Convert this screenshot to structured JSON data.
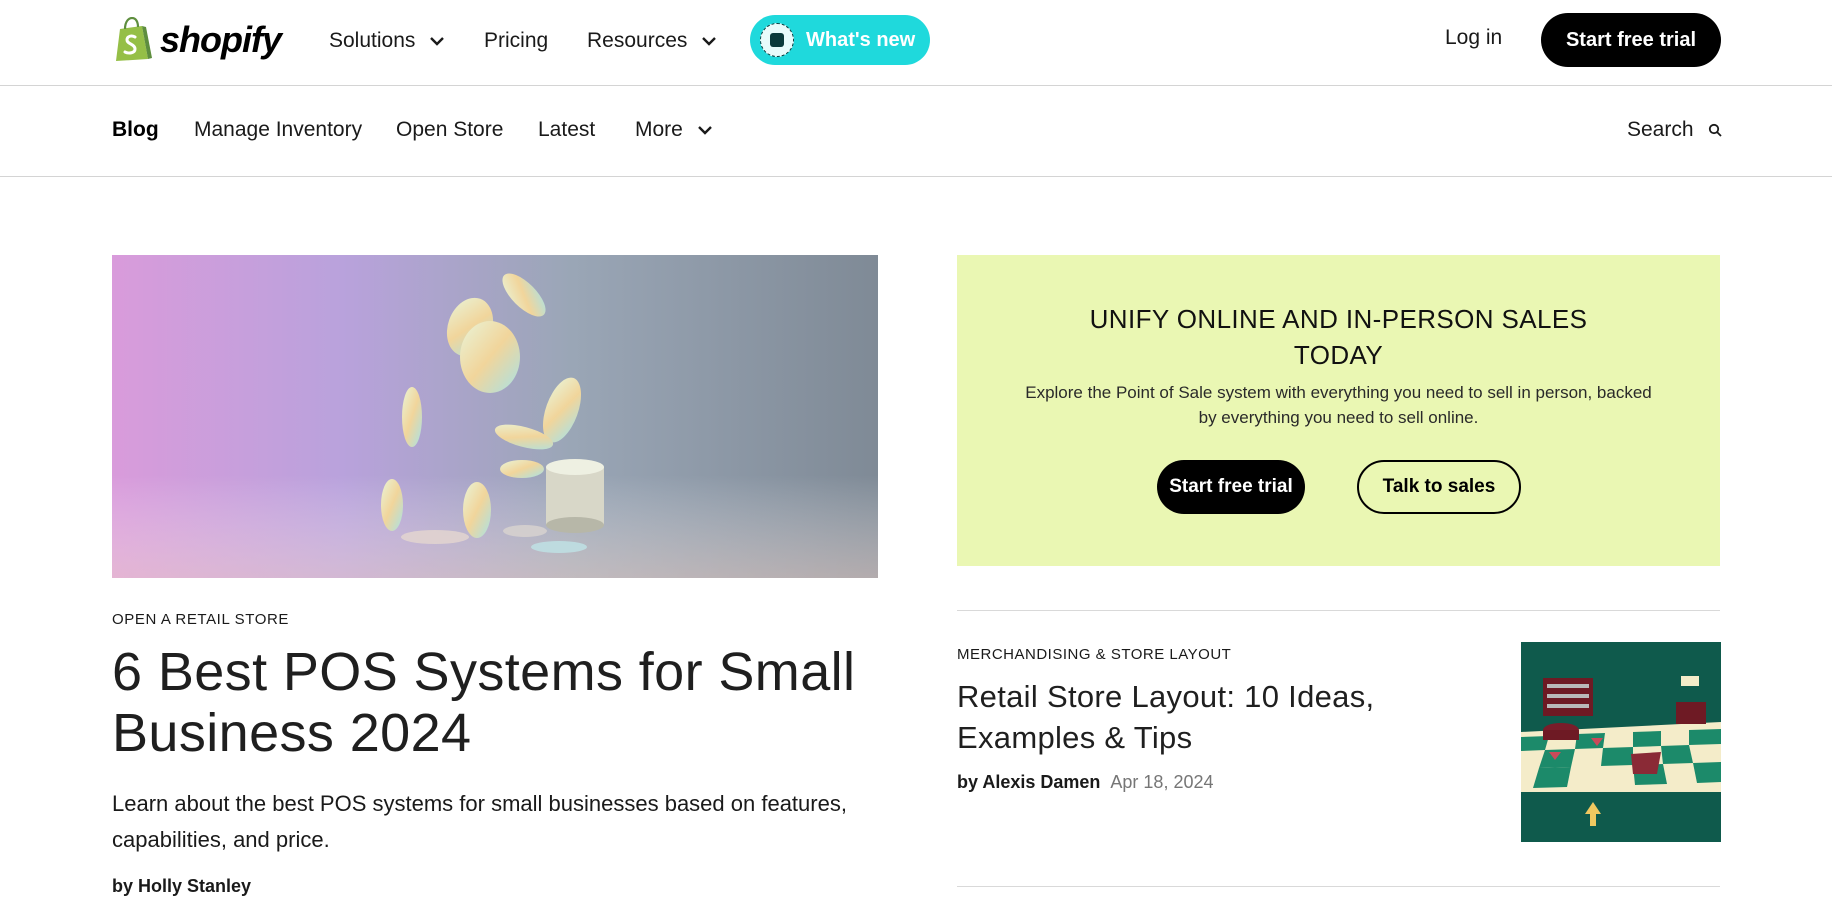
{
  "header": {
    "logo_text": "shopify",
    "nav": [
      {
        "label": "Solutions",
        "has_dropdown": true
      },
      {
        "label": "Pricing",
        "has_dropdown": false
      },
      {
        "label": "Resources",
        "has_dropdown": true
      }
    ],
    "whats_new_label": "What's new",
    "login_label": "Log in",
    "cta_label": "Start free trial"
  },
  "blog_nav": {
    "items": [
      "Blog",
      "Manage Inventory",
      "Open Store",
      "Latest",
      "More"
    ],
    "search_label": "Search"
  },
  "hero": {
    "category": "OPEN A RETAIL STORE",
    "title": "6 Best POS Systems for Small Business 2024",
    "description": "Learn about the best POS systems for small businesses based on features, capabilities, and price.",
    "author": "by Holly Stanley"
  },
  "promo": {
    "title": "UNIFY ONLINE AND IN-PERSON SALES TODAY",
    "description": "Explore the Point of Sale system with everything you need to sell in person, backed by everything you need to sell online.",
    "primary_label": "Start free trial",
    "secondary_label": "Talk to sales"
  },
  "side_article": {
    "category": "MERCHANDISING & STORE LAYOUT",
    "title": "Retail Store Layout: 10 Ideas, Examples & Tips",
    "author": "by Alexis Damen",
    "date": "Apr 18, 2024"
  },
  "colors": {
    "brand_green": "#95bf47",
    "whats_new_bg": "#1fd9dc",
    "promo_bg": "#eaf7b3",
    "cta_bg": "#000000"
  }
}
